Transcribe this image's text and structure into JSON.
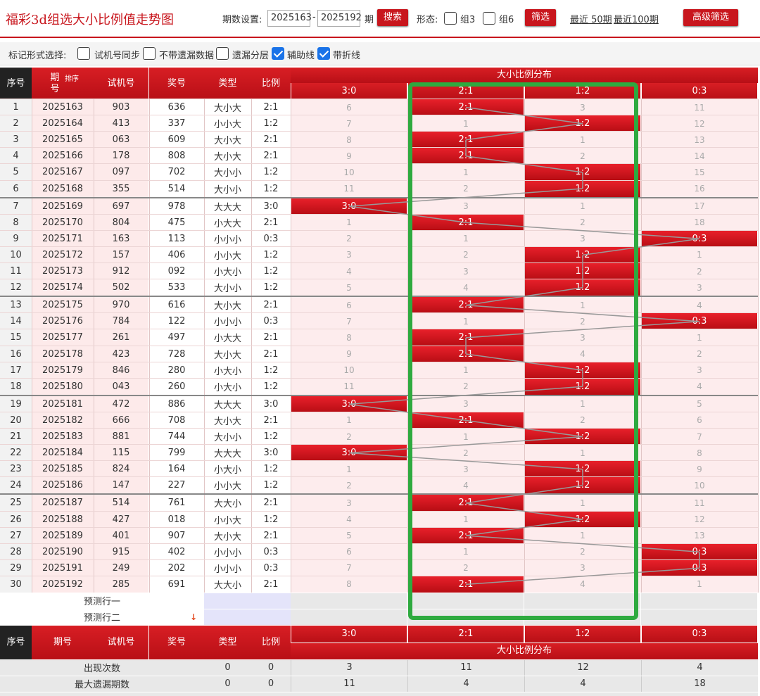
{
  "header": {
    "title": "福彩3d组选大小比例值走势图",
    "period_label": "期数设置:",
    "period_from": "2025163",
    "dash": "-",
    "period_to": "2025192",
    "period_unit": "期",
    "search_label": "搜索",
    "form_label": "形态:",
    "group3_label": "组3",
    "group6_label": "组6",
    "filter_label": "筛选",
    "recent50_label": "最近 50期",
    "recent100_label": "最近100期",
    "advanced_label": "高级筛选"
  },
  "options": {
    "label": "标记形式选择:",
    "items": [
      {
        "label": "试机号同步",
        "checked": false
      },
      {
        "label": "不带遗漏数据",
        "checked": false
      },
      {
        "label": "遗漏分层",
        "checked": false
      },
      {
        "label": "辅助线",
        "checked": true
      },
      {
        "label": "带折线",
        "checked": true
      }
    ]
  },
  "table": {
    "headers": {
      "seq": "序号",
      "period": "期号",
      "sort": "排序",
      "trial": "试机号",
      "prize": "奖号",
      "type": "类型",
      "ratio": "比例",
      "dist": "大小比例分布"
    },
    "dist_cols": [
      "3:0",
      "2:1",
      "1:2",
      "0:3"
    ],
    "rows": [
      {
        "seq": "1",
        "period": "2025163",
        "trial": "903",
        "prize": "636",
        "type": "大小大",
        "ratio": "2:1",
        "hit": 1,
        "miss": [
          "6",
          "",
          "3",
          "11"
        ]
      },
      {
        "seq": "2",
        "period": "2025164",
        "trial": "413",
        "prize": "337",
        "type": "小小大",
        "ratio": "1:2",
        "hit": 2,
        "miss": [
          "7",
          "1",
          "",
          "12"
        ]
      },
      {
        "seq": "3",
        "period": "2025165",
        "trial": "063",
        "prize": "609",
        "type": "大小大",
        "ratio": "2:1",
        "hit": 1,
        "miss": [
          "8",
          "",
          "1",
          "13"
        ]
      },
      {
        "seq": "4",
        "period": "2025166",
        "trial": "178",
        "prize": "808",
        "type": "大小大",
        "ratio": "2:1",
        "hit": 1,
        "miss": [
          "9",
          "",
          "2",
          "14"
        ]
      },
      {
        "seq": "5",
        "period": "2025167",
        "trial": "097",
        "prize": "702",
        "type": "大小小",
        "ratio": "1:2",
        "hit": 2,
        "miss": [
          "10",
          "1",
          "",
          "15"
        ]
      },
      {
        "seq": "6",
        "period": "2025168",
        "trial": "355",
        "prize": "514",
        "type": "大小小",
        "ratio": "1:2",
        "hit": 2,
        "miss": [
          "11",
          "2",
          "",
          "16"
        ]
      },
      {
        "seq": "7",
        "period": "2025169",
        "trial": "697",
        "prize": "978",
        "type": "大大大",
        "ratio": "3:0",
        "hit": 0,
        "miss": [
          "",
          "3",
          "1",
          "17"
        ]
      },
      {
        "seq": "8",
        "period": "2025170",
        "trial": "804",
        "prize": "475",
        "type": "小大大",
        "ratio": "2:1",
        "hit": 1,
        "miss": [
          "1",
          "",
          "2",
          "18"
        ]
      },
      {
        "seq": "9",
        "period": "2025171",
        "trial": "163",
        "prize": "113",
        "type": "小小小",
        "ratio": "0:3",
        "hit": 3,
        "miss": [
          "2",
          "1",
          "3",
          ""
        ]
      },
      {
        "seq": "10",
        "period": "2025172",
        "trial": "157",
        "prize": "406",
        "type": "小小大",
        "ratio": "1:2",
        "hit": 2,
        "miss": [
          "3",
          "2",
          "",
          "1"
        ]
      },
      {
        "seq": "11",
        "period": "2025173",
        "trial": "912",
        "prize": "092",
        "type": "小大小",
        "ratio": "1:2",
        "hit": 2,
        "miss": [
          "4",
          "3",
          "",
          "2"
        ]
      },
      {
        "seq": "12",
        "period": "2025174",
        "trial": "502",
        "prize": "533",
        "type": "大小小",
        "ratio": "1:2",
        "hit": 2,
        "miss": [
          "5",
          "4",
          "",
          "3"
        ]
      },
      {
        "seq": "13",
        "period": "2025175",
        "trial": "970",
        "prize": "616",
        "type": "大小大",
        "ratio": "2:1",
        "hit": 1,
        "miss": [
          "6",
          "",
          "1",
          "4"
        ]
      },
      {
        "seq": "14",
        "period": "2025176",
        "trial": "784",
        "prize": "122",
        "type": "小小小",
        "ratio": "0:3",
        "hit": 3,
        "miss": [
          "7",
          "1",
          "2",
          ""
        ]
      },
      {
        "seq": "15",
        "period": "2025177",
        "trial": "261",
        "prize": "497",
        "type": "小大大",
        "ratio": "2:1",
        "hit": 1,
        "miss": [
          "8",
          "",
          "3",
          "1"
        ]
      },
      {
        "seq": "16",
        "period": "2025178",
        "trial": "423",
        "prize": "728",
        "type": "大小大",
        "ratio": "2:1",
        "hit": 1,
        "miss": [
          "9",
          "",
          "4",
          "2"
        ]
      },
      {
        "seq": "17",
        "period": "2025179",
        "trial": "846",
        "prize": "280",
        "type": "小大小",
        "ratio": "1:2",
        "hit": 2,
        "miss": [
          "10",
          "1",
          "",
          "3"
        ]
      },
      {
        "seq": "18",
        "period": "2025180",
        "trial": "043",
        "prize": "260",
        "type": "小大小",
        "ratio": "1:2",
        "hit": 2,
        "miss": [
          "11",
          "2",
          "",
          "4"
        ]
      },
      {
        "seq": "19",
        "period": "2025181",
        "trial": "472",
        "prize": "886",
        "type": "大大大",
        "ratio": "3:0",
        "hit": 0,
        "miss": [
          "",
          "3",
          "1",
          "5"
        ]
      },
      {
        "seq": "20",
        "period": "2025182",
        "trial": "666",
        "prize": "708",
        "type": "大小大",
        "ratio": "2:1",
        "hit": 1,
        "miss": [
          "1",
          "",
          "2",
          "6"
        ]
      },
      {
        "seq": "21",
        "period": "2025183",
        "trial": "881",
        "prize": "744",
        "type": "大小小",
        "ratio": "1:2",
        "hit": 2,
        "miss": [
          "2",
          "1",
          "",
          "7"
        ]
      },
      {
        "seq": "22",
        "period": "2025184",
        "trial": "115",
        "prize": "799",
        "type": "大大大",
        "ratio": "3:0",
        "hit": 0,
        "miss": [
          "",
          "2",
          "1",
          "8"
        ]
      },
      {
        "seq": "23",
        "period": "2025185",
        "trial": "824",
        "prize": "164",
        "type": "小大小",
        "ratio": "1:2",
        "hit": 2,
        "miss": [
          "1",
          "3",
          "",
          "9"
        ]
      },
      {
        "seq": "24",
        "period": "2025186",
        "trial": "147",
        "prize": "227",
        "type": "小小大",
        "ratio": "1:2",
        "hit": 2,
        "miss": [
          "2",
          "4",
          "",
          "10"
        ]
      },
      {
        "seq": "25",
        "period": "2025187",
        "trial": "514",
        "prize": "761",
        "type": "大大小",
        "ratio": "2:1",
        "hit": 1,
        "miss": [
          "3",
          "",
          "1",
          "11"
        ]
      },
      {
        "seq": "26",
        "period": "2025188",
        "trial": "427",
        "prize": "018",
        "type": "小小大",
        "ratio": "1:2",
        "hit": 2,
        "miss": [
          "4",
          "1",
          "",
          "12"
        ]
      },
      {
        "seq": "27",
        "period": "2025189",
        "trial": "401",
        "prize": "907",
        "type": "大小大",
        "ratio": "2:1",
        "hit": 1,
        "miss": [
          "5",
          "",
          "1",
          "13"
        ]
      },
      {
        "seq": "28",
        "period": "2025190",
        "trial": "915",
        "prize": "402",
        "type": "小小小",
        "ratio": "0:3",
        "hit": 3,
        "miss": [
          "6",
          "1",
          "2",
          ""
        ]
      },
      {
        "seq": "29",
        "period": "2025191",
        "trial": "249",
        "prize": "202",
        "type": "小小小",
        "ratio": "0:3",
        "hit": 3,
        "miss": [
          "7",
          "2",
          "3",
          ""
        ]
      },
      {
        "seq": "30",
        "period": "2025192",
        "trial": "285",
        "prize": "691",
        "type": "大大小",
        "ratio": "2:1",
        "hit": 1,
        "miss": [
          "8",
          "",
          "4",
          "1"
        ]
      }
    ],
    "predict1": "预测行一",
    "predict2": "预测行二",
    "stats": [
      {
        "label": "出现次数",
        "type": "0",
        "ratio": "0",
        "vals": [
          "3",
          "11",
          "12",
          "4"
        ]
      },
      {
        "label": "最大遗漏期数",
        "type": "0",
        "ratio": "0",
        "vals": [
          "11",
          "4",
          "4",
          "18"
        ]
      }
    ]
  },
  "colors": {
    "accent": "#c8161d",
    "highlight_box": "#2eaa3f",
    "line": "#999999"
  }
}
